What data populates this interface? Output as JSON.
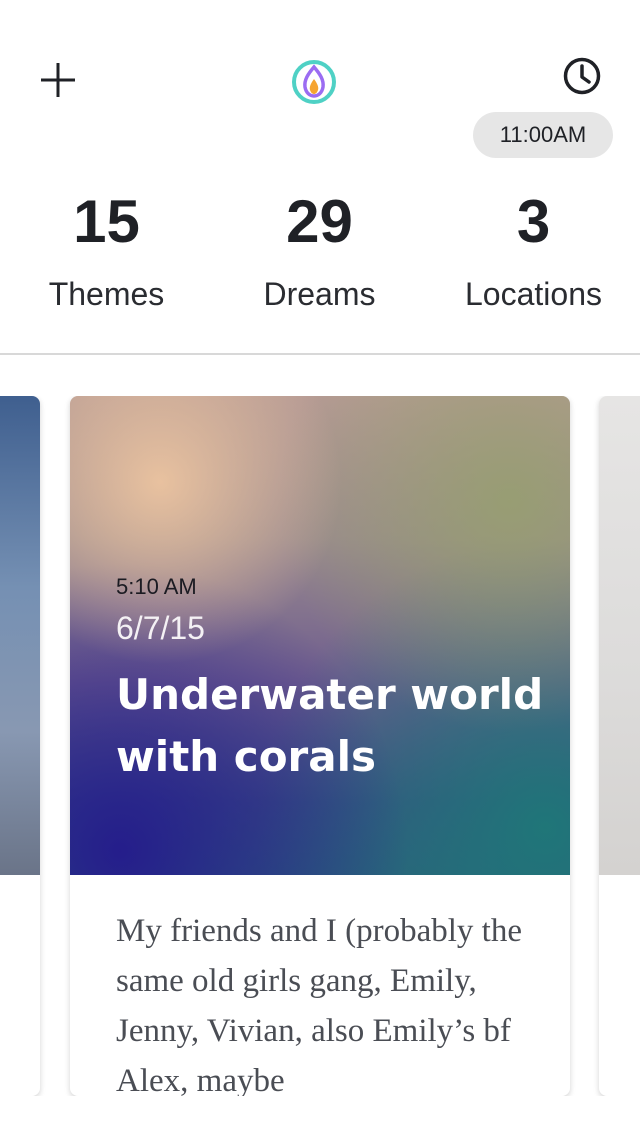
{
  "header": {
    "add_icon": "plus-icon",
    "logo_icon": "flame-logo",
    "clock_icon": "clock-icon",
    "time": "11:00AM"
  },
  "stats": [
    {
      "value": "15",
      "label": "Themes"
    },
    {
      "value": "29",
      "label": "Dreams"
    },
    {
      "value": "3",
      "label": "Locations"
    }
  ],
  "card": {
    "time": "5:10 AM",
    "date": "6/7/15",
    "title": "Underwater world with corals",
    "body": "My friends and I (probably the same old girls gang, Emily, Jenny, Vivian, also Emily’s bf Alex, maybe"
  },
  "colors": {
    "text": "#1f2126",
    "pill": "#e6e6e6",
    "divider": "#d8d8d8",
    "logo_ring": "#4fd1c5",
    "logo_flame_outer": "#9b6cf2",
    "logo_flame_inner": "#f6a531"
  }
}
